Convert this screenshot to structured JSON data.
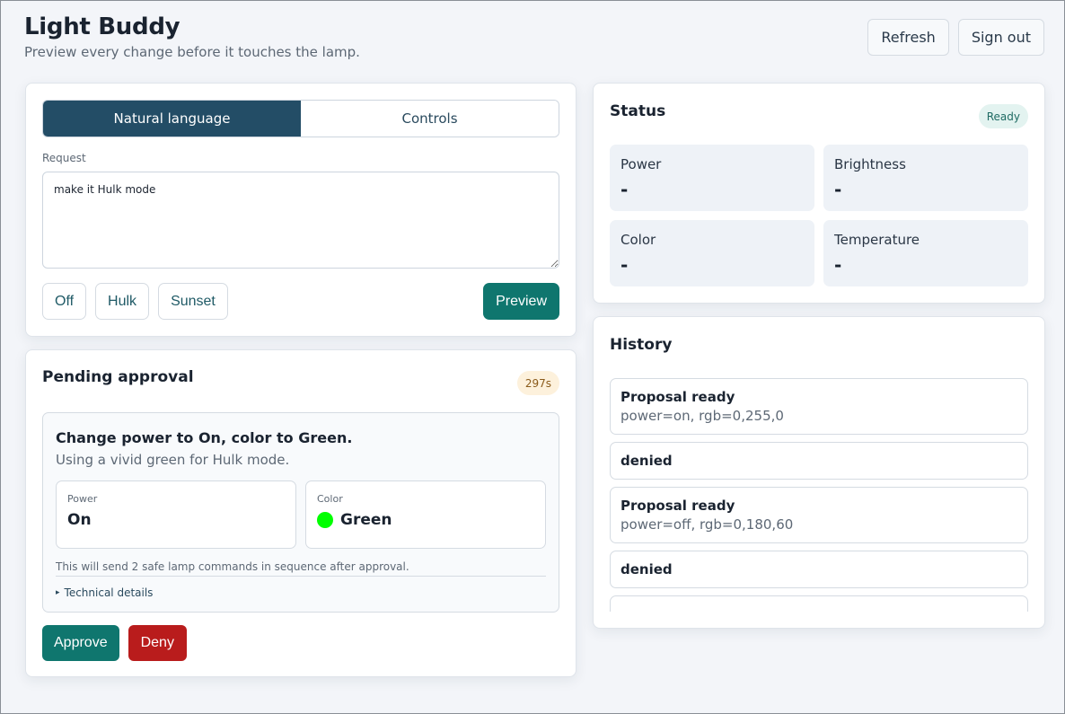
{
  "app": {
    "title": "Light Buddy",
    "subtitle": "Preview every change before it touches the lamp.",
    "refresh_label": "Refresh",
    "signout_label": "Sign out"
  },
  "request": {
    "tabs": [
      {
        "label": "Natural language",
        "active": true
      },
      {
        "label": "Controls",
        "active": false
      }
    ],
    "field_label": "Request",
    "value": "make it Hulk mode",
    "presets": [
      "Off",
      "Hulk",
      "Sunset"
    ],
    "preview_label": "Preview"
  },
  "pending": {
    "title": "Pending approval",
    "timer": "297s",
    "proposal": {
      "title": "Change power to On, color to Green.",
      "subtitle": "Using a vivid green for Hulk mode.",
      "power_label": "Power",
      "power_value": "On",
      "color_label": "Color",
      "color_value": "Green",
      "color_swatch": "#00ff00",
      "note": "This will send 2 safe lamp commands in sequence after approval.",
      "details_label": "Technical details"
    },
    "approve_label": "Approve",
    "deny_label": "Deny"
  },
  "status": {
    "title": "Status",
    "badge": "Ready",
    "items": [
      {
        "label": "Power",
        "value": "-"
      },
      {
        "label": "Brightness",
        "value": "-"
      },
      {
        "label": "Color",
        "value": "-"
      },
      {
        "label": "Temperature",
        "value": "-"
      }
    ]
  },
  "history": {
    "title": "History",
    "items": [
      {
        "title": "Proposal ready",
        "detail": "power=on, rgb=0,255,0"
      },
      {
        "title": "denied",
        "detail": ""
      },
      {
        "title": "Proposal ready",
        "detail": "power=off, rgb=0,180,60"
      },
      {
        "title": "denied",
        "detail": ""
      },
      {
        "title": "",
        "detail": ""
      }
    ]
  },
  "colors": {
    "accent": "#0f766e",
    "tab_active": "#234d66",
    "danger": "#b91c1c"
  }
}
